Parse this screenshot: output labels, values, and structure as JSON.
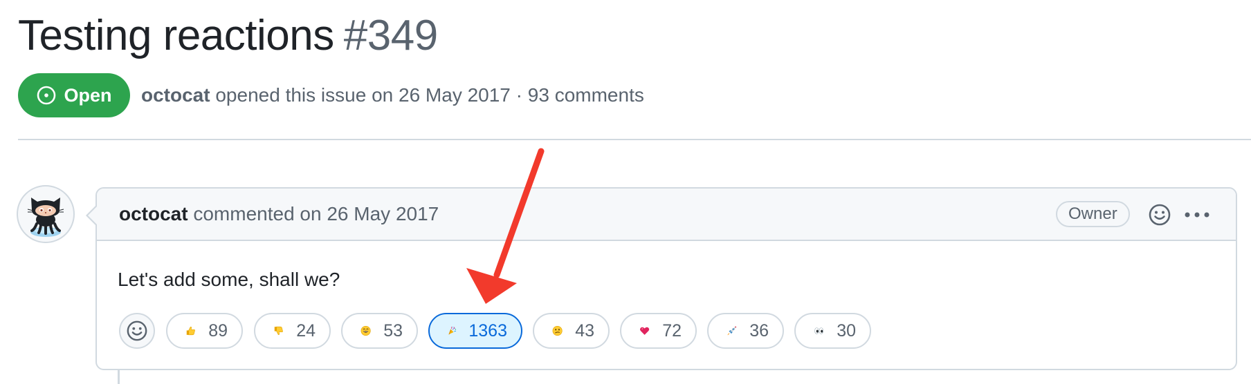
{
  "issue": {
    "title": "Testing reactions",
    "number": "#349",
    "state": "Open",
    "state_color": "#2da44e",
    "author": "octocat",
    "opened_text": "opened this issue on 26 May 2017",
    "separator": "·",
    "comments_count": "93 comments"
  },
  "comment": {
    "author": "octocat",
    "action_text": "commented on 26 May 2017",
    "role_label": "Owner",
    "body": "Let's add some, shall we?",
    "avatar_icon": "octocat-avatar"
  },
  "reactions": [
    {
      "emoji": "thumbs-up",
      "count": "89",
      "selected": false
    },
    {
      "emoji": "thumbs-down",
      "count": "24",
      "selected": false
    },
    {
      "emoji": "laugh",
      "count": "53",
      "selected": false
    },
    {
      "emoji": "hooray",
      "count": "1363",
      "selected": true
    },
    {
      "emoji": "confused",
      "count": "43",
      "selected": false
    },
    {
      "emoji": "heart",
      "count": "72",
      "selected": false
    },
    {
      "emoji": "rocket",
      "count": "36",
      "selected": false
    },
    {
      "emoji": "eyes",
      "count": "30",
      "selected": false
    }
  ],
  "icons": {
    "state": "issue-opened-icon",
    "add_reaction": "smiley-icon",
    "header_reaction": "smiley-icon",
    "more": "kebab-horizontal-icon"
  },
  "annotation": {
    "arrow_color": "#f23a2c"
  },
  "colors": {
    "accent_blue": "#0969da",
    "selected_bg": "#ddf4ff",
    "muted_text": "#59636e",
    "border": "#d1d9e0"
  }
}
